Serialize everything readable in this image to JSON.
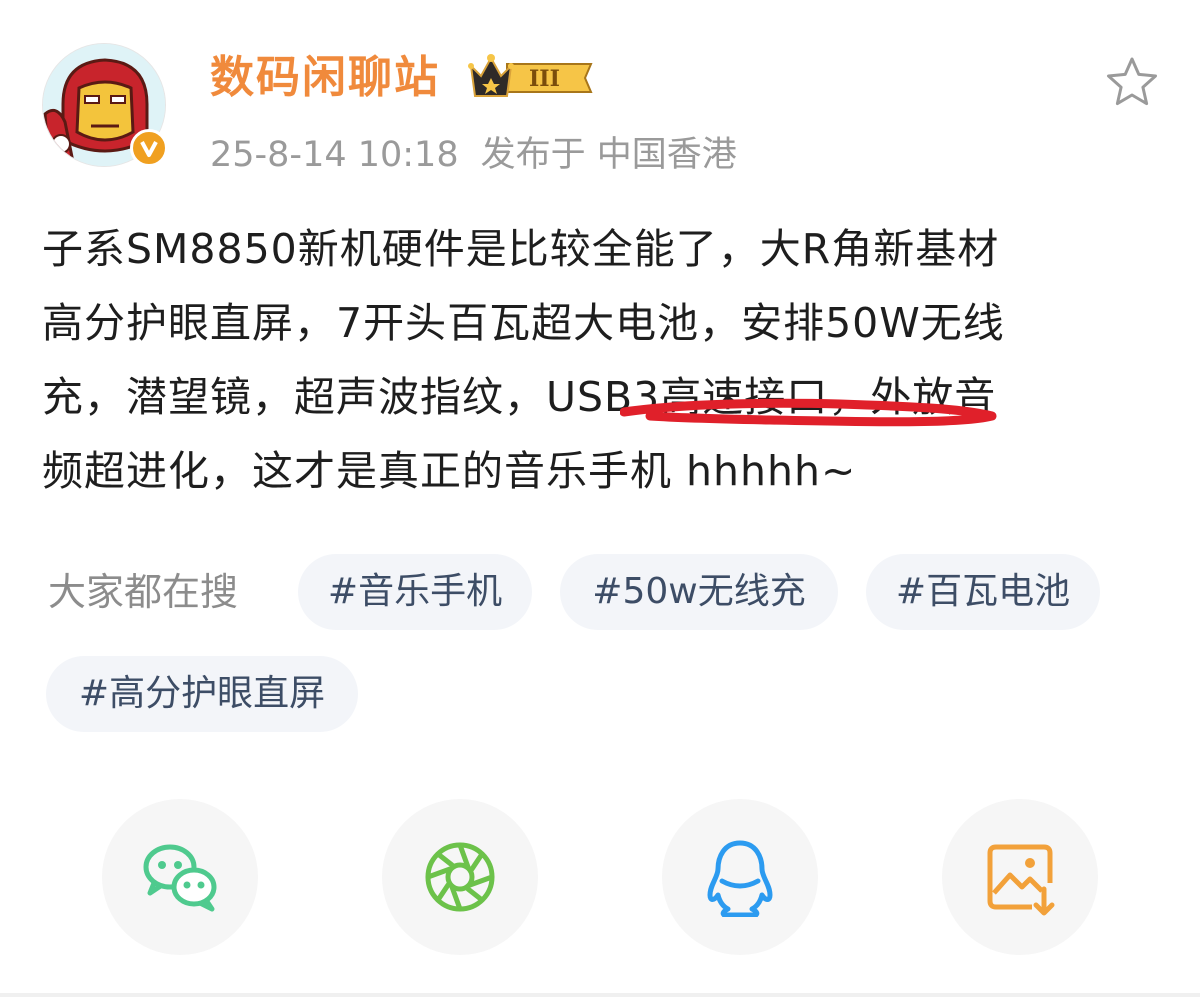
{
  "post": {
    "author": {
      "name": "数码闲聊站",
      "vip_level": "III"
    },
    "meta": {
      "time": "25-8-14 10:18",
      "location": "发布于 中国香港"
    },
    "content_lines": [
      "子系SM8850新机硬件是比较全能了，大R角新基材",
      "高分护眼直屏，7开头百瓦超大电池，安排50W无线",
      "充，潜望镜，超声波指纹，",
      "USB3高速接口",
      "，外放音",
      "频超进化，这才是真正的音乐手机 hhhhh~"
    ],
    "hot_search": {
      "label": "大家都在搜",
      "tags": [
        "#音乐手机",
        "#50w无线充",
        "#百瓦电池",
        "#高分护眼直屏"
      ]
    },
    "share": [
      "wechat-icon",
      "moments-icon",
      "qq-icon",
      "save-image-icon"
    ],
    "colors": {
      "username": "#f08a3c",
      "underline": "#e0202a",
      "wechat": "#4fca8e",
      "moments": "#6cc24a",
      "qq": "#2c9bf0",
      "save": "#f2a13a"
    }
  }
}
